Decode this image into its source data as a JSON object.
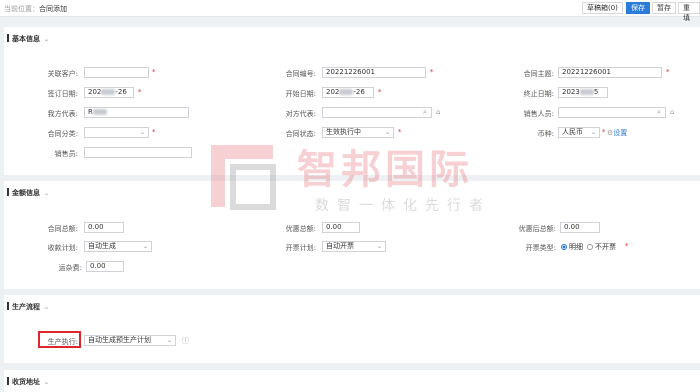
{
  "header": {
    "crumb_prefix": "当前位置：",
    "crumb_page": "合同添加",
    "draft_btn": "草稿箱(0)",
    "save_btn": "保存",
    "hold_btn": "暂存",
    "reset_btn": "重填"
  },
  "basic": {
    "title": "基本信息",
    "labels": {
      "customer": "关联客户:",
      "contract_no": "合同编号:",
      "subject": "合同主题:",
      "sign_date": "签订日期:",
      "start_date": "开始日期:",
      "end_date": "终止日期:",
      "our_rep": "我方代表:",
      "their_rep": "对方代表:",
      "sales_person": "销售人员:",
      "category": "合同分类:",
      "status": "合同状态:",
      "currency": "币种:",
      "salesman": "销售员:"
    },
    "values": {
      "contract_no": "20221226001",
      "subject": "20221226001",
      "sign_date_a": "202",
      "sign_date_b": "-26",
      "start_date_a": "202",
      "start_date_b": "-26",
      "end_date_a": "2023",
      "end_date_b": "5",
      "our_rep": "R",
      "status": "生效执行中",
      "currency": "人民币",
      "settings_link": "设置"
    }
  },
  "amount": {
    "title": "金额信息",
    "labels": {
      "total": "合同总额:",
      "discount_total": "优惠总额:",
      "after_discount": "优惠后总额:",
      "collection_plan": "收款计划:",
      "invoice_plan": "开票计划:",
      "invoice_type": "开票类型:",
      "shipping": "运杂费:"
    },
    "values": {
      "total": "0.00",
      "discount_total": "0.00",
      "after_discount": "0.00",
      "collection_plan": "自动生成",
      "invoice_plan": "自动开票",
      "invoice_yes": "明细",
      "invoice_no": "不开票",
      "shipping": "0.00"
    }
  },
  "production": {
    "title": "生产流程",
    "label": "生产执行:",
    "value": "自动生成预生产计划"
  },
  "delivery": {
    "title": "收货地址"
  },
  "watermark": {
    "title": "智邦国际",
    "subtitle": "数智一体化先行者"
  },
  "colors": {
    "accent": "#2b7bd8",
    "required": "#e0262c",
    "watermark": "#e77c80"
  }
}
